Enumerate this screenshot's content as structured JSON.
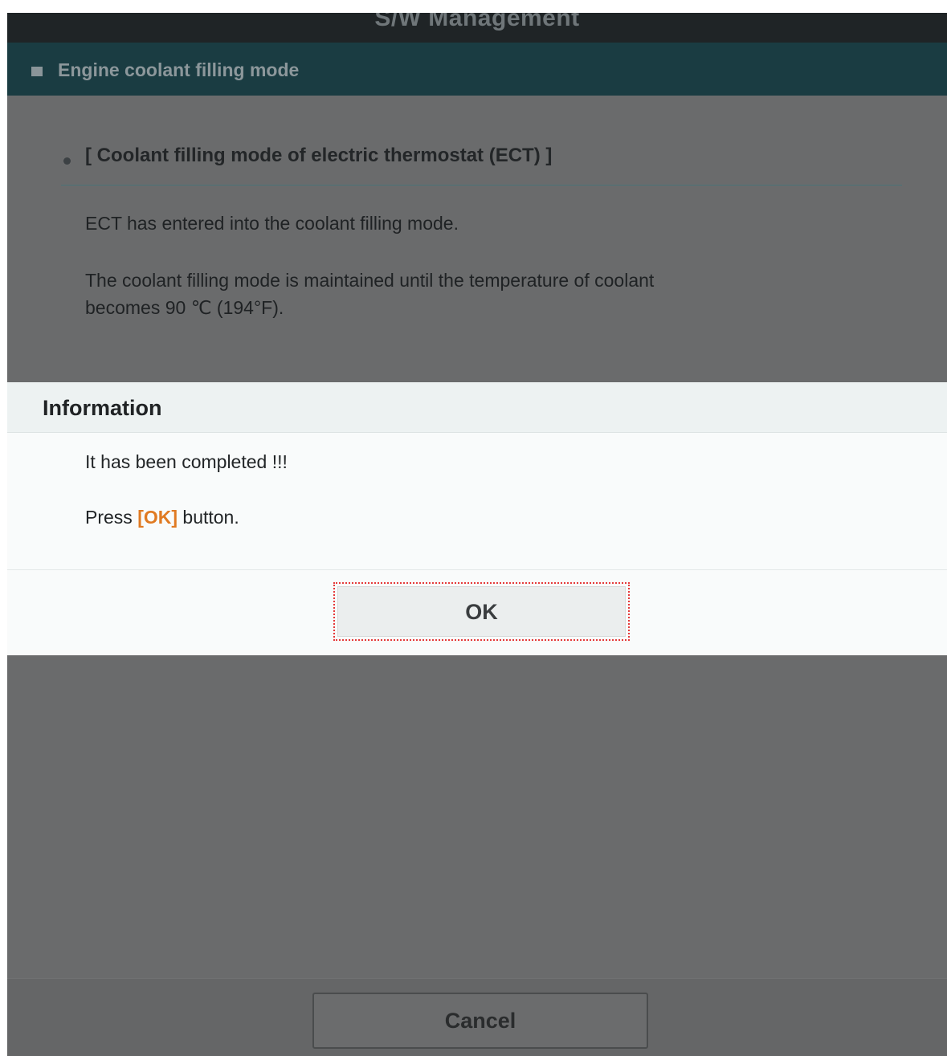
{
  "window": {
    "title": "S/W Management"
  },
  "section": {
    "header": "Engine coolant filling mode",
    "heading": "[ Coolant filling mode of electric thermostat (ECT) ]",
    "paragraph1": "ECT has entered into the coolant filling mode.",
    "paragraph2_line1": "The coolant filling mode is maintained until the temperature of coolant",
    "paragraph2_line2": "becomes 90 ℃ (194°F)."
  },
  "dialog": {
    "title": "Information",
    "message1": "It has been completed !!!",
    "message2_prefix": "Press ",
    "message2_highlight": "[OK]",
    "message2_suffix": " button.",
    "ok_label": "OK"
  },
  "footer": {
    "cancel_label": "Cancel"
  },
  "colors": {
    "highlight": "#e07a22",
    "focus_outline": "#e53a3a",
    "section_header": "#1a3c42"
  },
  "icons": {
    "section_marker": "square-bullet-icon",
    "heading_marker": "dot-bullet-icon"
  }
}
